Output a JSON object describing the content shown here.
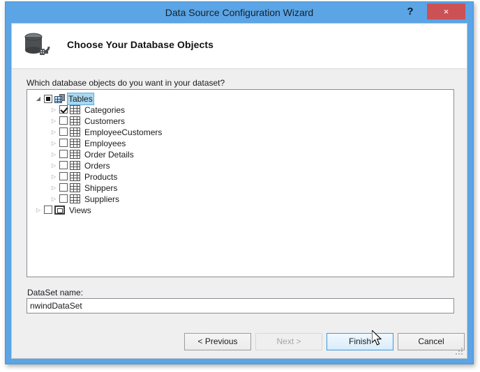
{
  "window": {
    "title": "Data Source Configuration Wizard",
    "help_label": "?",
    "close_label": "×",
    "accent_color": "#5ba4e5",
    "close_color": "#cb5155"
  },
  "header": {
    "icon": "database-connection-icon",
    "heading": "Choose Your Database Objects"
  },
  "prompt": "Which database objects do you want in your dataset?",
  "tree": {
    "nodes": [
      {
        "label": "Tables",
        "level": 0,
        "icon": "tables-folder-icon",
        "check": "partial",
        "expander": "expanded",
        "selected": true
      },
      {
        "label": "Categories",
        "level": 1,
        "icon": "table-icon",
        "check": "checked",
        "expander": "collapsed",
        "selected": false
      },
      {
        "label": "Customers",
        "level": 1,
        "icon": "table-icon",
        "check": "unchecked",
        "expander": "collapsed",
        "selected": false
      },
      {
        "label": "EmployeeCustomers",
        "level": 1,
        "icon": "table-icon",
        "check": "unchecked",
        "expander": "collapsed",
        "selected": false
      },
      {
        "label": "Employees",
        "level": 1,
        "icon": "table-icon",
        "check": "unchecked",
        "expander": "collapsed",
        "selected": false
      },
      {
        "label": "Order Details",
        "level": 1,
        "icon": "table-icon",
        "check": "unchecked",
        "expander": "collapsed",
        "selected": false
      },
      {
        "label": "Orders",
        "level": 1,
        "icon": "table-icon",
        "check": "unchecked",
        "expander": "collapsed",
        "selected": false
      },
      {
        "label": "Products",
        "level": 1,
        "icon": "table-icon",
        "check": "unchecked",
        "expander": "collapsed",
        "selected": false
      },
      {
        "label": "Shippers",
        "level": 1,
        "icon": "table-icon",
        "check": "unchecked",
        "expander": "collapsed",
        "selected": false
      },
      {
        "label": "Suppliers",
        "level": 1,
        "icon": "table-icon",
        "check": "unchecked",
        "expander": "collapsed",
        "selected": false
      },
      {
        "label": "Views",
        "level": 0,
        "icon": "views-folder-icon",
        "check": "unchecked",
        "expander": "collapsed",
        "selected": false
      }
    ]
  },
  "dataset": {
    "label": "DataSet name:",
    "value": "nwindDataSet",
    "placeholder": ""
  },
  "buttons": {
    "previous": "< Previous",
    "next": "Next >",
    "finish": "Finish",
    "cancel": "Cancel"
  }
}
